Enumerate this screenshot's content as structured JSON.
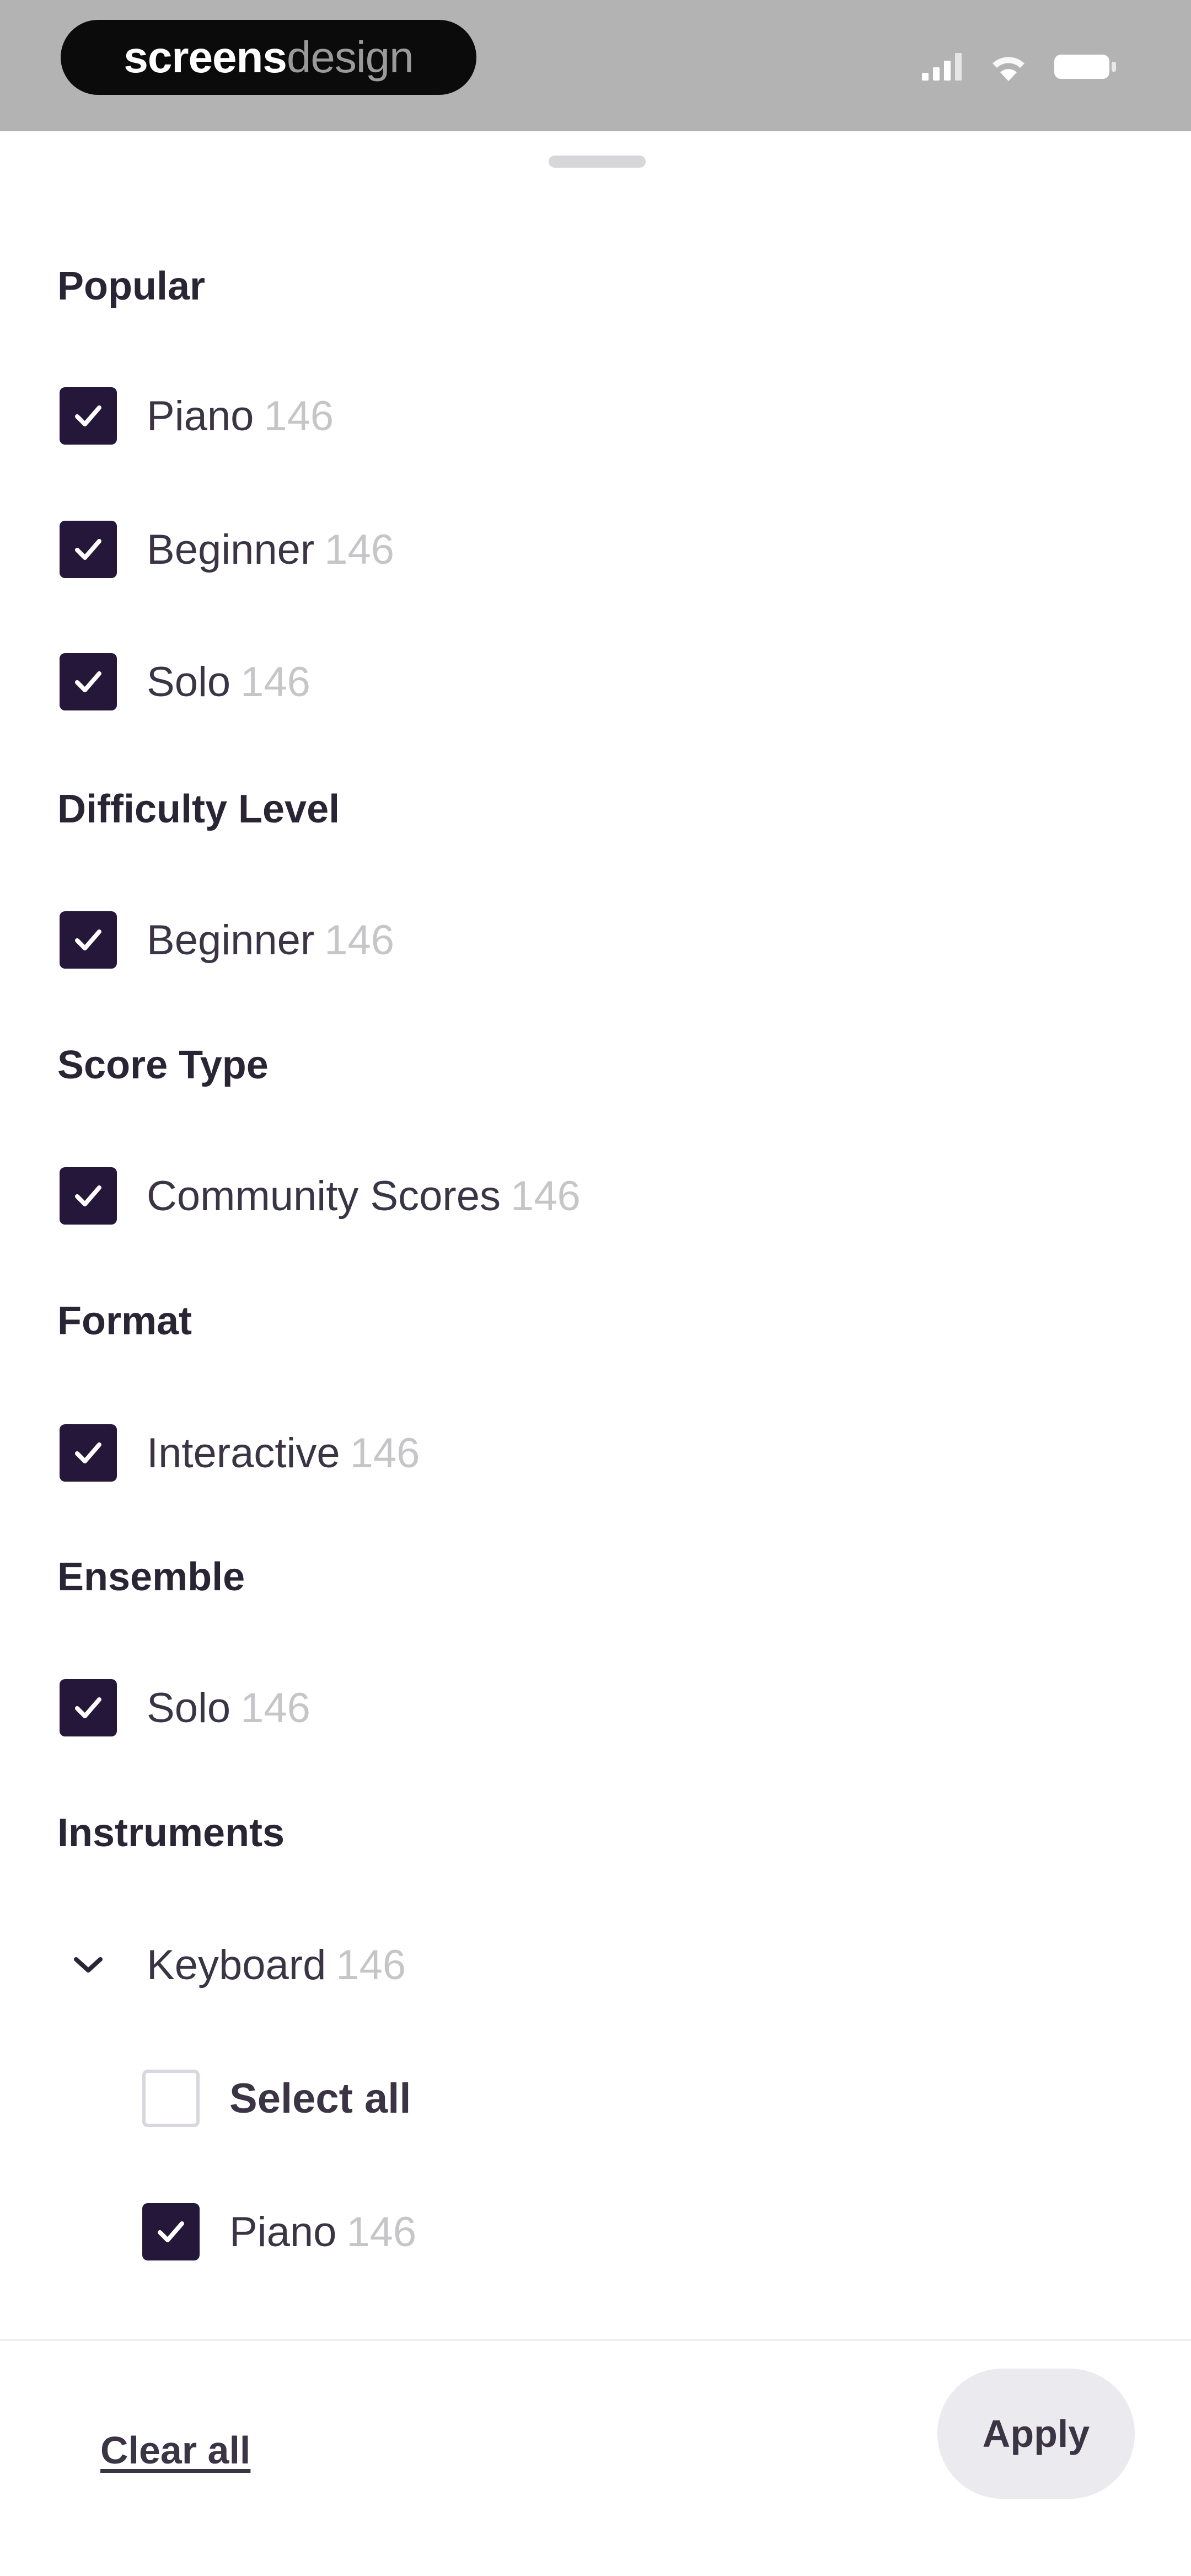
{
  "status_bar": {
    "brand_strong": "screens",
    "brand_light": "design",
    "icons": [
      "signal-icon",
      "wifi-icon",
      "battery-icon"
    ]
  },
  "sections": {
    "popular": {
      "title": "Popular",
      "items": [
        {
          "label": "Piano",
          "count": "146",
          "checked": true
        },
        {
          "label": "Beginner",
          "count": "146",
          "checked": true
        },
        {
          "label": "Solo",
          "count": "146",
          "checked": true
        }
      ]
    },
    "difficulty": {
      "title": "Difficulty Level",
      "items": [
        {
          "label": "Beginner",
          "count": "146",
          "checked": true
        }
      ]
    },
    "score_type": {
      "title": "Score Type",
      "items": [
        {
          "label": "Community Scores",
          "count": "146",
          "checked": true
        }
      ]
    },
    "format": {
      "title": "Format",
      "items": [
        {
          "label": "Interactive",
          "count": "146",
          "checked": true
        }
      ]
    },
    "ensemble": {
      "title": "Ensemble",
      "items": [
        {
          "label": "Solo",
          "count": "146",
          "checked": true
        }
      ]
    },
    "instruments": {
      "title": "Instruments",
      "group": {
        "label": "Keyboard",
        "count": "146",
        "expanded": true
      },
      "select_all": {
        "label": "Select all",
        "checked": false
      },
      "items": [
        {
          "label": "Piano",
          "count": "146",
          "checked": true
        }
      ]
    }
  },
  "footer": {
    "clear_all": "Clear all",
    "apply": "Apply"
  },
  "colors": {
    "accent": "#241739",
    "text": "#3a3444",
    "muted": "#c6c6c9",
    "status_bar": "#b3b3b3"
  }
}
